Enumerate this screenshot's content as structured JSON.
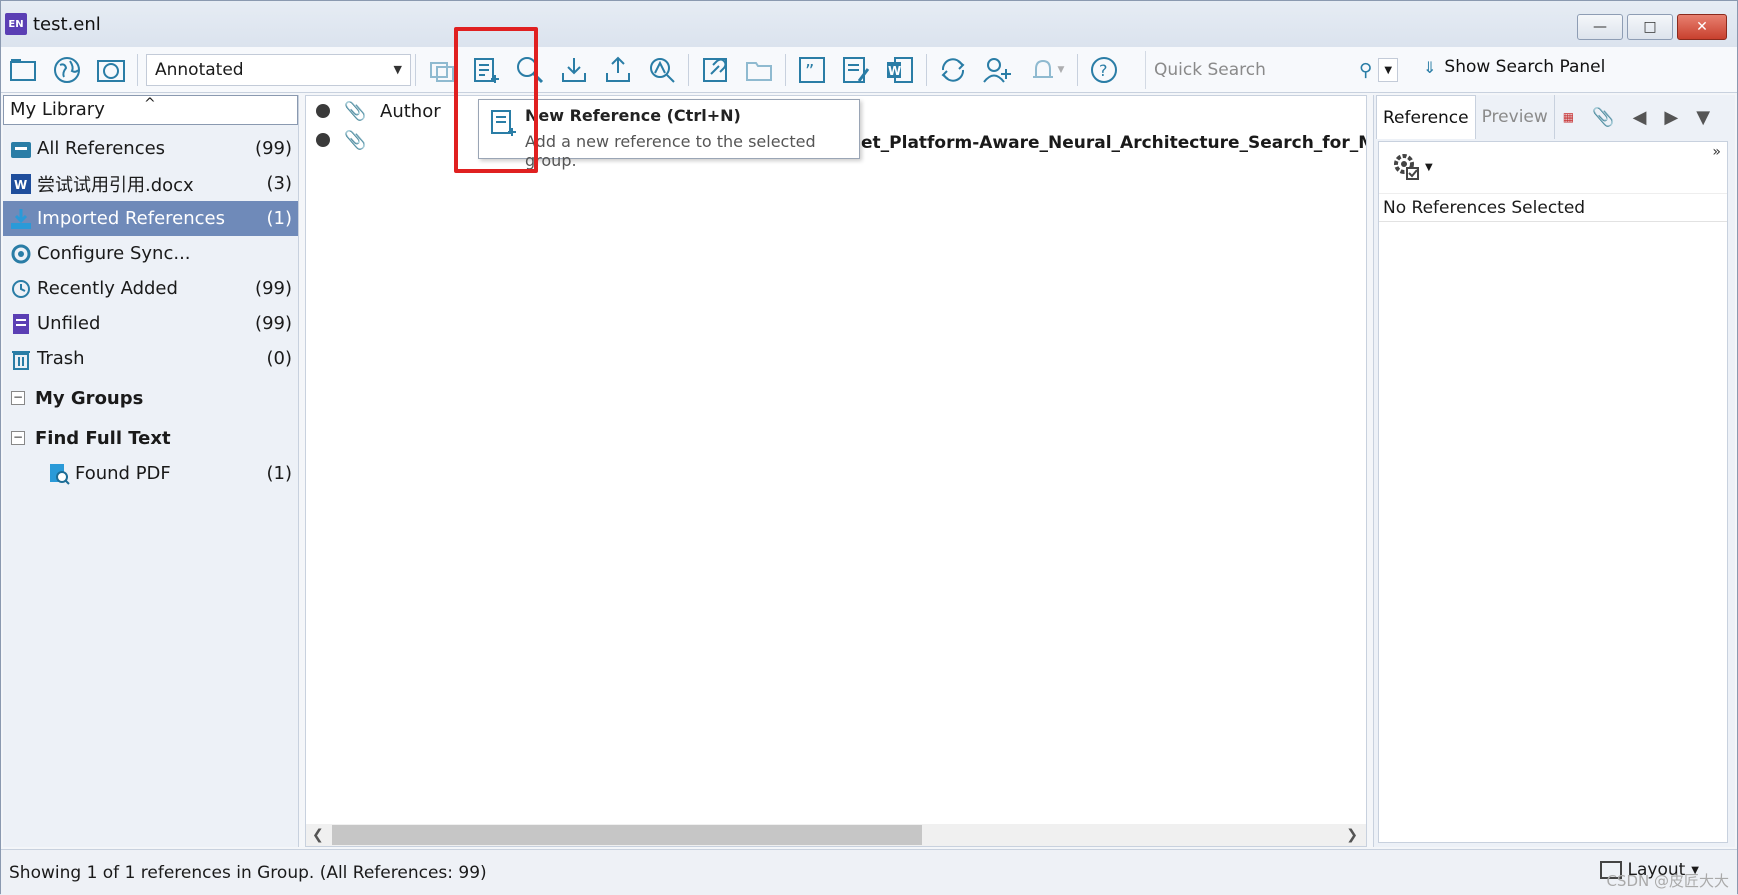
{
  "window": {
    "title": "test.enl",
    "logo": "EN"
  },
  "toolbar": {
    "style": "Annotated",
    "search_placeholder": "Quick Search",
    "show_search_panel": "Show Search Panel"
  },
  "library": {
    "header": "My Library",
    "items": [
      {
        "label": "All References",
        "count": "(99)"
      },
      {
        "label": "尝试试用引用.docx",
        "count": "(3)"
      },
      {
        "label": "Imported References",
        "count": "(1)"
      },
      {
        "label": "Configure Sync...",
        "count": ""
      },
      {
        "label": "Recently Added",
        "count": "(99)"
      },
      {
        "label": "Unfiled",
        "count": "(99)"
      },
      {
        "label": "Trash",
        "count": "(0)"
      }
    ],
    "my_groups": "My Groups",
    "find_full_text": "Find Full Text",
    "found_pdf": {
      "label": "Found PDF",
      "count": "(1)"
    }
  },
  "list": {
    "author_col": "Author",
    "row_title": "et_Platform-Aware_Neural_Architecture_Search_for_Mobile_C"
  },
  "tooltip": {
    "title": "New Reference (Ctrl+N)",
    "desc": "Add a new reference to the selected group."
  },
  "right": {
    "tab_reference": "Reference",
    "tab_preview": "Preview",
    "no_refs": "No References Selected"
  },
  "status": {
    "text": "Showing 1 of 1 references in Group. (All References: 99)",
    "layout": "Layout",
    "watermark": "CSDN @皮匠大大"
  },
  "colors": {
    "accent": "#2a7da6",
    "selected": "#6f8ab9",
    "highlight": "#e02020"
  }
}
